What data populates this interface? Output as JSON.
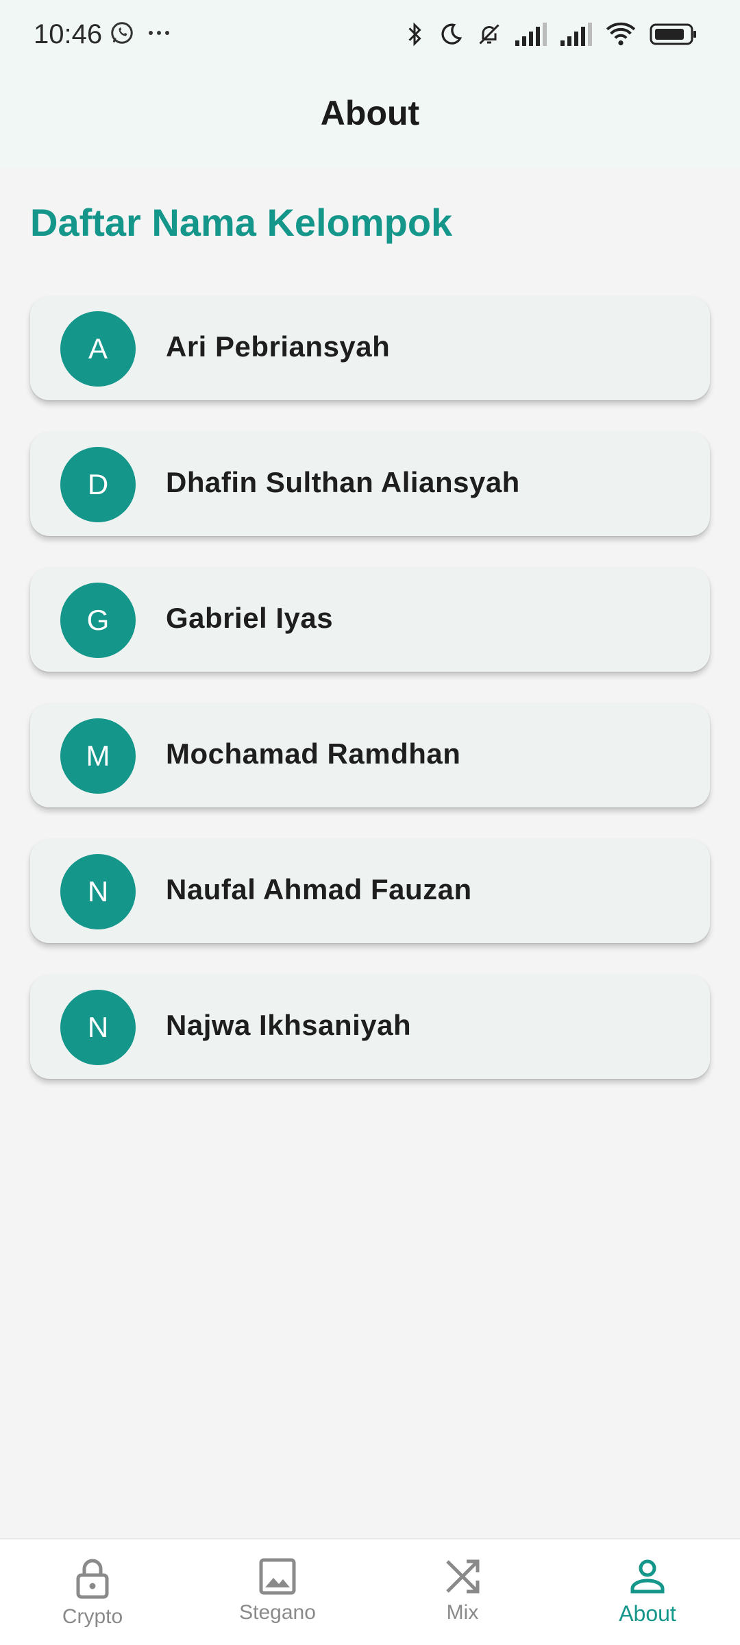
{
  "status_bar": {
    "time": "10:46",
    "left_icons": [
      "whatsapp-icon",
      "more-dots-icon"
    ],
    "right_icons": [
      "bluetooth-icon",
      "moon-icon",
      "bell-off-icon",
      "signal-icon",
      "signal-icon",
      "wifi-icon",
      "battery-icon"
    ]
  },
  "top_bar": {
    "title": "About"
  },
  "section": {
    "title": "Daftar Nama Kelompok"
  },
  "members": [
    {
      "initial": "A",
      "name": "Ari Pebriansyah"
    },
    {
      "initial": "D",
      "name": "Dhafin Sulthan Aliansyah"
    },
    {
      "initial": "G",
      "name": "Gabriel Iyas"
    },
    {
      "initial": "M",
      "name": "Mochamad Ramdhan"
    },
    {
      "initial": "N",
      "name": "Naufal Ahmad Fauzan"
    },
    {
      "initial": "N",
      "name": "Najwa Ikhsaniyah"
    }
  ],
  "bottom_nav": {
    "items": [
      {
        "label": "Crypto",
        "icon": "lock-icon"
      },
      {
        "label": "Stegano",
        "icon": "image-icon"
      },
      {
        "label": "Mix",
        "icon": "shuffle-icon"
      },
      {
        "label": "About",
        "icon": "person-icon",
        "active": true
      }
    ]
  },
  "colors": {
    "accent": "#14968a",
    "background": "#f4f4f4",
    "card": "#eef3f1",
    "top_bar": "#f1f7f5"
  }
}
